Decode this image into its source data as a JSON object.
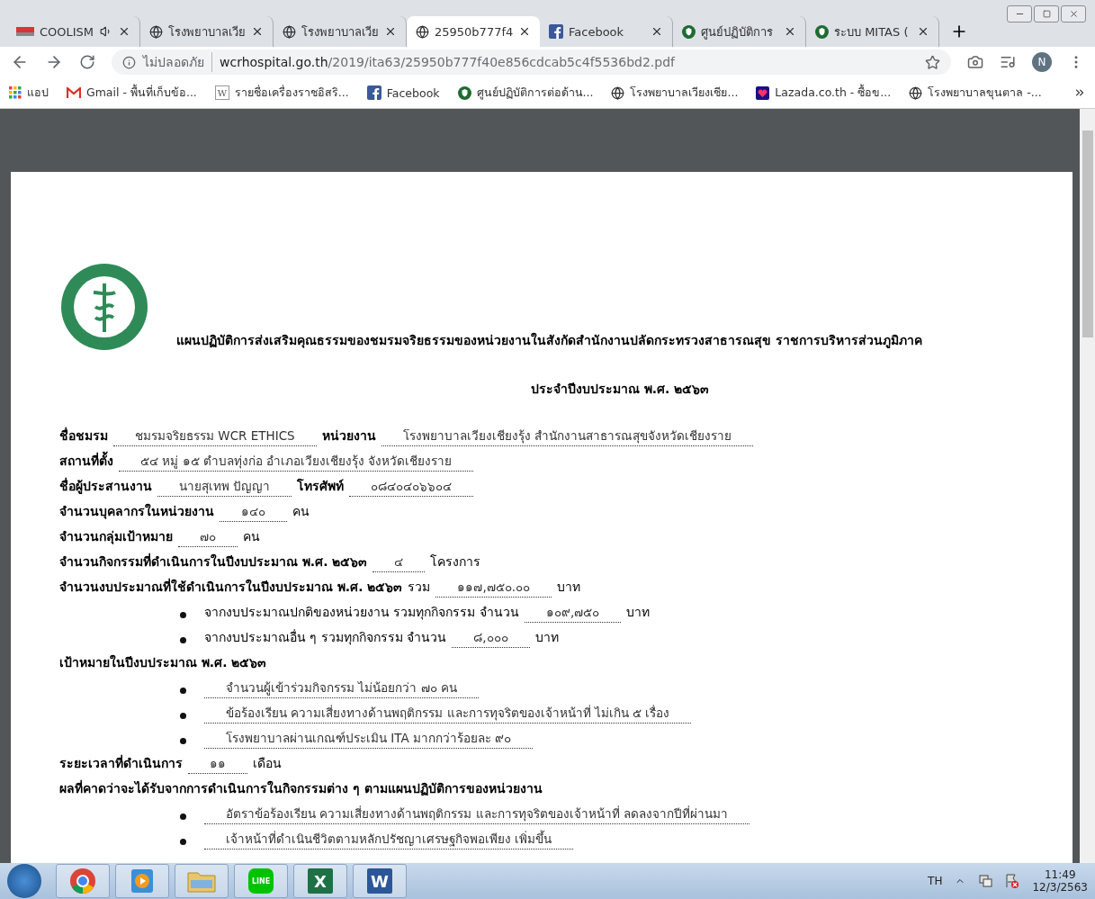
{
  "tabs": [
    {
      "kind": "cool",
      "title": "COOLISM",
      "audio": true,
      "selected": false
    },
    {
      "kind": "globe",
      "title": "โรงพยาบาลเวีย",
      "audio": false,
      "selected": false
    },
    {
      "kind": "globe",
      "title": "โรงพยาบาลเวีย",
      "audio": false,
      "selected": false
    },
    {
      "kind": "globe",
      "title": "25950b777f4",
      "audio": false,
      "selected": true
    },
    {
      "kind": "facebook",
      "title": "Facebook",
      "audio": false,
      "selected": false
    },
    {
      "kind": "shield",
      "title": "ศูนย์ปฏิบัติการ",
      "audio": false,
      "selected": false
    },
    {
      "kind": "shield",
      "title": "ระบบ MITAS (",
      "audio": false,
      "selected": false
    }
  ],
  "address": {
    "security": "ไม่ปลอดภัย",
    "domain": "wcrhospital.go.th",
    "path": "/2019/ita63/25950b777f40e856cdcab5c4f5536bd2.pdf"
  },
  "profile": {
    "initial": "N"
  },
  "bookmarks": [
    {
      "kind": "apps",
      "label": "แอป"
    },
    {
      "kind": "gmail",
      "label": "Gmail - พื้นที่เก็บข้อ..."
    },
    {
      "kind": "letter",
      "badge": "W",
      "label": "รายชื่อเครื่องราชอิสริ..."
    },
    {
      "kind": "facebook",
      "label": "Facebook"
    },
    {
      "kind": "shield",
      "label": "ศูนย์ปฏิบัติการต่อด้าน..."
    },
    {
      "kind": "globe",
      "label": "โรงพยาบาลเวียงเชีย..."
    },
    {
      "kind": "lazada",
      "label": "Lazada.co.th - ซื้อข..."
    },
    {
      "kind": "globe",
      "label": "โรงพยาบาลขุนตาล -..."
    }
  ],
  "document": {
    "title": "แผนปฏิบัติการส่งเสริมคุณธรรมของชมรมจริยธรรมของหน่วยงานในสังกัดสำนักงานปลัดกระทรวงสาธารณสุข ราชการบริหารส่วนภูมิภาค",
    "subtitle": "ประจำปีงบประมาณ พ.ศ. ๒๕๖๓",
    "lines": [
      {
        "kind": "line",
        "parts": [
          {
            "kind": "label",
            "text": "ชื่อชมรม"
          },
          {
            "kind": "fill",
            "text": "ชมรมจริยธรรม  WCR ETHICS"
          },
          {
            "kind": "label",
            "text": "หน่วยงาน"
          },
          {
            "kind": "fill",
            "text": "โรงพยาบาลเวียงเชียงรุ้ง สำนักงานสาธารณสุขจังหวัดเชียงราย"
          }
        ]
      },
      {
        "kind": "line",
        "parts": [
          {
            "kind": "label",
            "text": "สถานที่ตั้ง"
          },
          {
            "kind": "fill",
            "text": "๕๔ หมู่ ๑๕ ตำบลทุ่งก่อ อำเภอเวียงเชียงรุ้ง จังหวัดเชียงราย"
          }
        ]
      },
      {
        "kind": "line",
        "parts": [
          {
            "kind": "label",
            "text": "ชื่อผู้ประสานงาน"
          },
          {
            "kind": "fill",
            "text": "นายสุเทพ  ปัญญา"
          },
          {
            "kind": "label",
            "text": "โทรศัพท์"
          },
          {
            "kind": "fill",
            "text": "๐๘๔๐๔๐๖๖๐๔"
          }
        ]
      },
      {
        "kind": "line",
        "parts": [
          {
            "kind": "label",
            "text": "จำนวนบุคลากรในหน่วยงาน"
          },
          {
            "kind": "fill",
            "text": "๑๔๐"
          },
          {
            "kind": "text",
            "text": "คน"
          }
        ]
      },
      {
        "kind": "line",
        "parts": [
          {
            "kind": "label",
            "text": "จำนวนกลุ่มเป้าหมาย"
          },
          {
            "kind": "fill",
            "text": "๗๐"
          },
          {
            "kind": "text",
            "text": "คน"
          }
        ]
      },
      {
        "kind": "line",
        "parts": [
          {
            "kind": "label",
            "text": "จำนวนกิจกรรมที่ดำเนินการในปีงบประมาณ พ.ศ. ๒๕๖๓"
          },
          {
            "kind": "fill",
            "text": "๔"
          },
          {
            "kind": "text",
            "text": "โครงการ"
          }
        ]
      },
      {
        "kind": "line",
        "parts": [
          {
            "kind": "label",
            "text": "จำนวนงบประมาณที่ใช้ดำเนินการในปีงบประมาณ พ.ศ. ๒๕๖๓"
          },
          {
            "kind": "text",
            "text": "รวม"
          },
          {
            "kind": "fill",
            "text": "๑๑๗,๗๕๐.๐๐"
          },
          {
            "kind": "text",
            "text": "บาท"
          }
        ]
      },
      {
        "kind": "bullet",
        "parts": [
          {
            "kind": "text",
            "text": "จากงบประมาณปกติของหน่วยงาน รวมทุกกิจกรรม จำนวน"
          },
          {
            "kind": "fill",
            "text": "๑๐๙,๗๕๐"
          },
          {
            "kind": "text",
            "text": "บาท"
          }
        ]
      },
      {
        "kind": "bullet",
        "parts": [
          {
            "kind": "text",
            "text": "จากงบประมาณอื่น ๆ รวมทุกกิจกรรม จำนวน"
          },
          {
            "kind": "fill",
            "text": "๘,๐๐๐"
          },
          {
            "kind": "text",
            "text": "บาท"
          }
        ]
      },
      {
        "kind": "line",
        "parts": [
          {
            "kind": "label",
            "text": "เป้าหมายในปีงบประมาณ พ.ศ. ๒๕๖๓"
          }
        ]
      },
      {
        "kind": "bullet",
        "parts": [
          {
            "kind": "fill",
            "text": "จำนวนผู้เข้าร่วมกิจกรรม ไม่น้อยกว่า ๗๐ คน"
          }
        ]
      },
      {
        "kind": "bullet",
        "parts": [
          {
            "kind": "fill",
            "text": "ข้อร้องเรียน ความเสี่ยงทางด้านพฤติกรรม และการทุจริตของเจ้าหน้าที่ ไม่เกิน ๕ เรื่อง"
          }
        ]
      },
      {
        "kind": "bullet",
        "parts": [
          {
            "kind": "fill",
            "text": "โรงพยาบาลผ่านเกณฑ์ประเมิน ITA  มากกว่าร้อยละ ๙๐"
          }
        ]
      },
      {
        "kind": "line",
        "parts": [
          {
            "kind": "label",
            "text": "ระยะเวลาที่ดำเนินการ"
          },
          {
            "kind": "fill",
            "text": "๑๑"
          },
          {
            "kind": "text",
            "text": "เดือน"
          }
        ]
      },
      {
        "kind": "line",
        "parts": [
          {
            "kind": "label",
            "text": "ผลที่คาดว่าจะได้รับจากการดำเนินการในกิจกรรมต่าง ๆ ตามแผนปฏิบัติการของหน่วยงาน"
          }
        ]
      },
      {
        "kind": "bullet",
        "parts": [
          {
            "kind": "fill",
            "text": "อัตราข้อร้องเรียน ความเสี่ยงทางด้านพฤติกรรม และการทุจริตของเจ้าหน้าที่ ลดลงจากปีที่ผ่านมา"
          }
        ]
      },
      {
        "kind": "bullet",
        "parts": [
          {
            "kind": "fill",
            "text": "เจ้าหน้าที่ดำเนินชีวิตตามหลักปรัชญาเศรษฐกิจพอเพียง เพิ่มขึ้น"
          }
        ]
      }
    ]
  },
  "taskbar": {
    "apps": [
      {
        "kind": "chrome"
      },
      {
        "kind": "media"
      },
      {
        "kind": "folder"
      },
      {
        "kind": "chat",
        "label": "LINE"
      },
      {
        "kind": "sheet",
        "label": "X"
      },
      {
        "kind": "doc",
        "label": "W"
      }
    ],
    "language": "TH",
    "time": "11:49",
    "date": "12/3/2563"
  }
}
